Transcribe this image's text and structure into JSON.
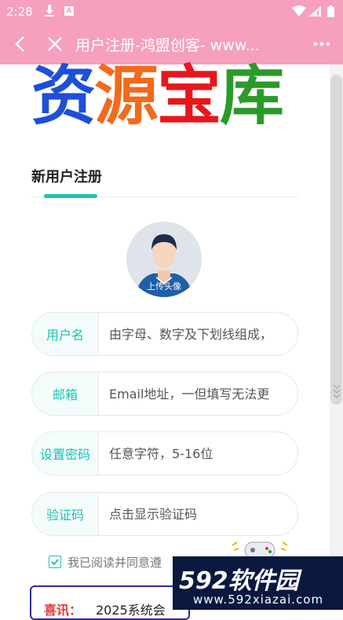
{
  "statusbar": {
    "time": "2:28",
    "a_badge": "A"
  },
  "toolbar": {
    "title": "用户注册-鸿盟创客- www..."
  },
  "logo": {
    "chars": [
      "资",
      "源",
      "宝",
      "库"
    ],
    "colors": [
      "#1e4fd8",
      "#f26a1b",
      "#e8161b",
      "#2a9a2a"
    ]
  },
  "section": {
    "title": "新用户注册"
  },
  "avatar": {
    "label": "上传头像"
  },
  "form": {
    "username": {
      "label": "用户名",
      "placeholder": "由字母、数字及下划线组成，"
    },
    "email": {
      "label": "邮箱",
      "placeholder": "Email地址，一但填写无法更"
    },
    "password": {
      "label": "设置密码",
      "placeholder": "任意字符，5-16位"
    },
    "captcha": {
      "label": "验证码",
      "placeholder": "点击显示验证码"
    }
  },
  "agree": {
    "text": "我已阅读并同意遵"
  },
  "news": {
    "label": "喜讯：",
    "text": "2025系统会"
  },
  "watermark": {
    "big": "592软件园",
    "small": "www.592xiazai.com"
  },
  "colors": {
    "accent": "#1ec2b3",
    "header": "#f69fbf"
  }
}
